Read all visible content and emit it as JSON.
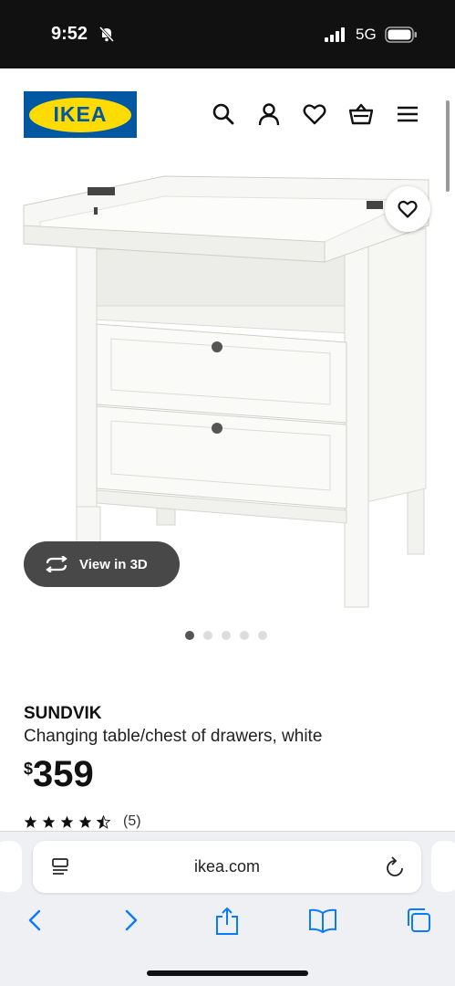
{
  "status_bar": {
    "time": "9:52",
    "network": "5G"
  },
  "header": {
    "logo_text": "IKEA",
    "icons": [
      "search-icon",
      "account-icon",
      "heart-icon",
      "basket-icon",
      "menu-icon"
    ]
  },
  "gallery": {
    "view_3d_label": "View in 3D",
    "image_count": 5,
    "active_index": 0
  },
  "product": {
    "name": "SUNDVIK",
    "description": "Changing table/chest of drawers, white",
    "currency_symbol": "$",
    "price": "359",
    "rating": 4.5,
    "rating_count": "(5)"
  },
  "browser": {
    "url": "ikea.com"
  },
  "colors": {
    "ikea_blue": "#0058a3",
    "ikea_yellow": "#ffdb00",
    "pill_bg": "#484848",
    "ios_blue": "#0a7aff"
  }
}
